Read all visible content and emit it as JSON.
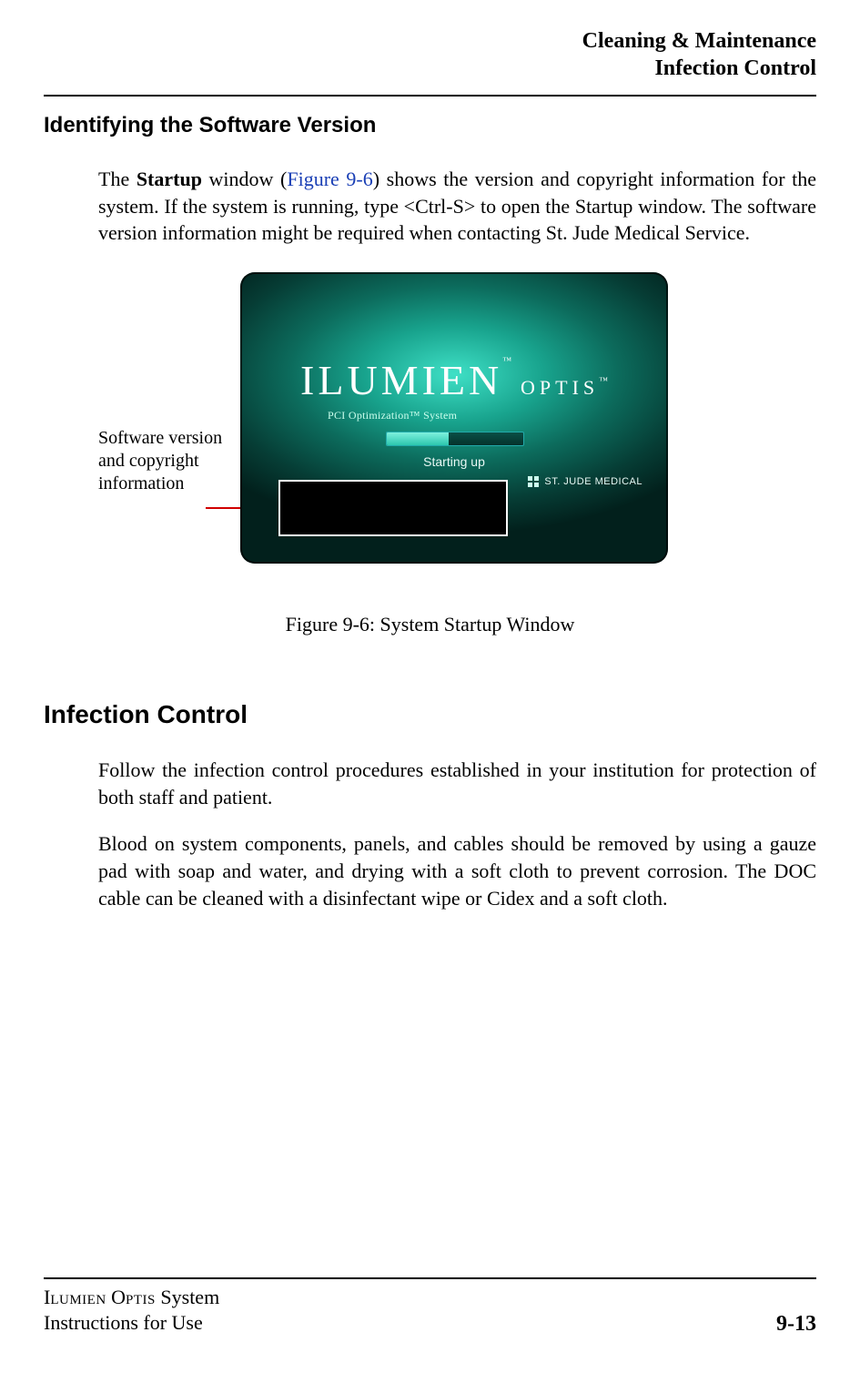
{
  "header": {
    "line1": "Cleaning & Maintenance",
    "line2": "Infection Control"
  },
  "section1": {
    "heading": "Identifying the Software Version",
    "para_pre": "The ",
    "para_bold": "Startup",
    "para_mid": " window (",
    "figref": "Figure 9-6",
    "para_post": ") shows the version and copyright information for the system. If the system is running, type <Ctrl-S> to open the Startup window. The software version information might be required when contacting St. Jude Medical Service."
  },
  "callout": {
    "text": "Software version and copyright information"
  },
  "startup": {
    "brand_main": "ILUMIEN",
    "brand_sub": "OPTIS",
    "tm": "™",
    "tagline": "PCI Optimization™ System",
    "starting": "Starting up",
    "sjm": "ST. JUDE MEDICAL"
  },
  "figure": {
    "caption": "Figure 9-6:  System Startup Window"
  },
  "section2": {
    "heading": "Infection Control",
    "p1": "Follow the infection control procedures established in your institution for protection of both staff and patient.",
    "p2": "Blood on system components, panels, and cables should be removed by using a gauze pad with soap and water, and drying with a soft cloth to prevent corrosion. The DOC cable can be cleaned with a disinfectant wipe or Cidex and a soft cloth."
  },
  "footer": {
    "left_line1_a": "I",
    "left_line1_b": "lumien",
    "left_line1_c": " O",
    "left_line1_d": "ptis",
    "left_line1_e": " System",
    "left_line2": "Instructions for Use",
    "page": "9-13"
  }
}
